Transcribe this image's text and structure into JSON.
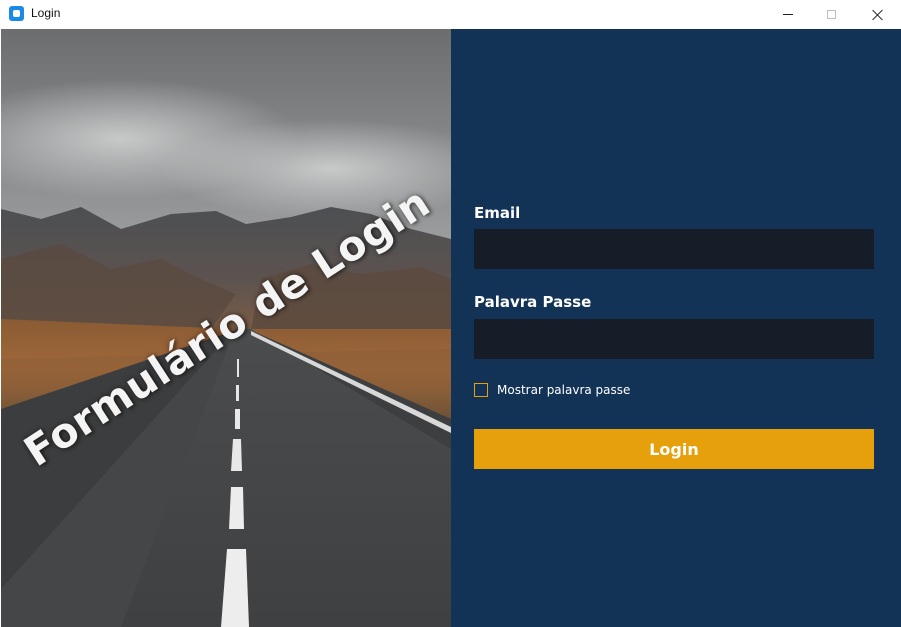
{
  "window": {
    "title": "Login",
    "icon": "app-icon",
    "controls": [
      "minimize-icon",
      "maximize-icon",
      "close-icon"
    ]
  },
  "image_panel": {
    "overlay_text": "Formulário de Login",
    "scene": "mountain road under cloudy sky"
  },
  "form": {
    "email_label": "Email",
    "email_value": "",
    "password_label": "Palavra Passe",
    "password_value": "",
    "show_password_label": "Mostrar palavra passe",
    "show_password_checked": false,
    "login_button": "Login"
  },
  "colors": {
    "panel_bg": "#123256",
    "input_bg": "#161c28",
    "accent": "#e6a00c"
  }
}
